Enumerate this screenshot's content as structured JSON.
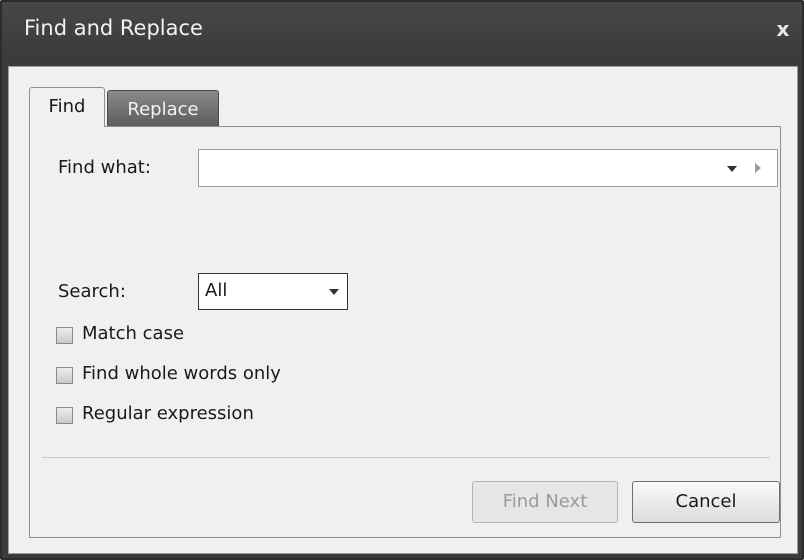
{
  "dialog": {
    "title": "Find and Replace",
    "close_glyph": "x"
  },
  "tabs": [
    {
      "label": "Find",
      "selected": true
    },
    {
      "label": "Replace",
      "selected": false
    }
  ],
  "find": {
    "label": "Find what:",
    "value": "",
    "placeholder": ""
  },
  "search": {
    "label": "Search:",
    "selected": "All"
  },
  "options": [
    {
      "label": "Match case",
      "checked": false
    },
    {
      "label": "Find whole words only",
      "checked": false
    },
    {
      "label": "Regular expression",
      "checked": false
    }
  ],
  "buttons": {
    "find_next": "Find Next",
    "find_next_enabled": false,
    "cancel": "Cancel"
  },
  "icons": {
    "close": "close-icon",
    "dropdown": "chevron-down-icon",
    "expand": "chevron-right-icon"
  },
  "colors": {
    "titlebar": "#3b3b3b",
    "client": "#f0f0f0",
    "tab_inactive": "#6e6e6e"
  }
}
